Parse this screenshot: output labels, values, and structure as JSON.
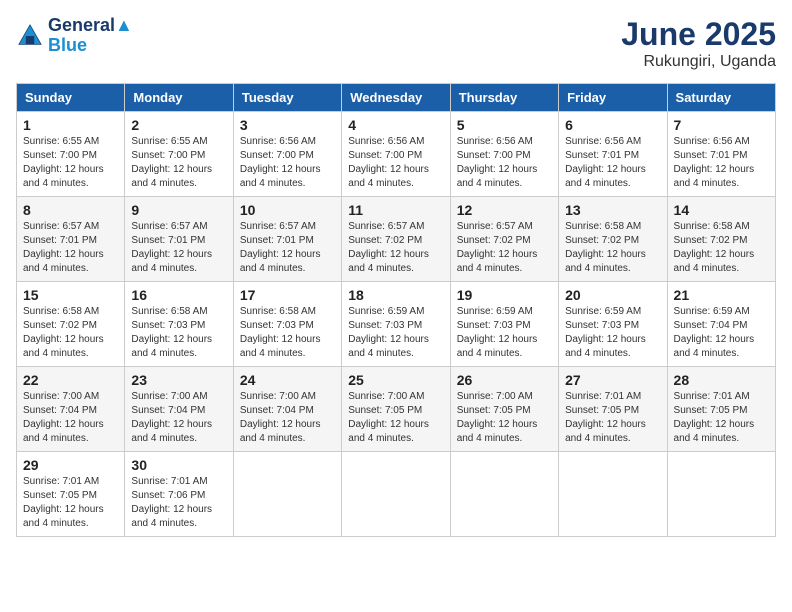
{
  "header": {
    "logo_line1": "General",
    "logo_line2": "Blue",
    "title": "June 2025",
    "subtitle": "Rukungiri, Uganda"
  },
  "columns": [
    "Sunday",
    "Monday",
    "Tuesday",
    "Wednesday",
    "Thursday",
    "Friday",
    "Saturday"
  ],
  "weeks": [
    [
      {
        "day": "1",
        "sunrise": "6:55 AM",
        "sunset": "7:00 PM",
        "daylight": "12 hours and 4 minutes."
      },
      {
        "day": "2",
        "sunrise": "6:55 AM",
        "sunset": "7:00 PM",
        "daylight": "12 hours and 4 minutes."
      },
      {
        "day": "3",
        "sunrise": "6:56 AM",
        "sunset": "7:00 PM",
        "daylight": "12 hours and 4 minutes."
      },
      {
        "day": "4",
        "sunrise": "6:56 AM",
        "sunset": "7:00 PM",
        "daylight": "12 hours and 4 minutes."
      },
      {
        "day": "5",
        "sunrise": "6:56 AM",
        "sunset": "7:00 PM",
        "daylight": "12 hours and 4 minutes."
      },
      {
        "day": "6",
        "sunrise": "6:56 AM",
        "sunset": "7:01 PM",
        "daylight": "12 hours and 4 minutes."
      },
      {
        "day": "7",
        "sunrise": "6:56 AM",
        "sunset": "7:01 PM",
        "daylight": "12 hours and 4 minutes."
      }
    ],
    [
      {
        "day": "8",
        "sunrise": "6:57 AM",
        "sunset": "7:01 PM",
        "daylight": "12 hours and 4 minutes."
      },
      {
        "day": "9",
        "sunrise": "6:57 AM",
        "sunset": "7:01 PM",
        "daylight": "12 hours and 4 minutes."
      },
      {
        "day": "10",
        "sunrise": "6:57 AM",
        "sunset": "7:01 PM",
        "daylight": "12 hours and 4 minutes."
      },
      {
        "day": "11",
        "sunrise": "6:57 AM",
        "sunset": "7:02 PM",
        "daylight": "12 hours and 4 minutes."
      },
      {
        "day": "12",
        "sunrise": "6:57 AM",
        "sunset": "7:02 PM",
        "daylight": "12 hours and 4 minutes."
      },
      {
        "day": "13",
        "sunrise": "6:58 AM",
        "sunset": "7:02 PM",
        "daylight": "12 hours and 4 minutes."
      },
      {
        "day": "14",
        "sunrise": "6:58 AM",
        "sunset": "7:02 PM",
        "daylight": "12 hours and 4 minutes."
      }
    ],
    [
      {
        "day": "15",
        "sunrise": "6:58 AM",
        "sunset": "7:02 PM",
        "daylight": "12 hours and 4 minutes."
      },
      {
        "day": "16",
        "sunrise": "6:58 AM",
        "sunset": "7:03 PM",
        "daylight": "12 hours and 4 minutes."
      },
      {
        "day": "17",
        "sunrise": "6:58 AM",
        "sunset": "7:03 PM",
        "daylight": "12 hours and 4 minutes."
      },
      {
        "day": "18",
        "sunrise": "6:59 AM",
        "sunset": "7:03 PM",
        "daylight": "12 hours and 4 minutes."
      },
      {
        "day": "19",
        "sunrise": "6:59 AM",
        "sunset": "7:03 PM",
        "daylight": "12 hours and 4 minutes."
      },
      {
        "day": "20",
        "sunrise": "6:59 AM",
        "sunset": "7:03 PM",
        "daylight": "12 hours and 4 minutes."
      },
      {
        "day": "21",
        "sunrise": "6:59 AM",
        "sunset": "7:04 PM",
        "daylight": "12 hours and 4 minutes."
      }
    ],
    [
      {
        "day": "22",
        "sunrise": "7:00 AM",
        "sunset": "7:04 PM",
        "daylight": "12 hours and 4 minutes."
      },
      {
        "day": "23",
        "sunrise": "7:00 AM",
        "sunset": "7:04 PM",
        "daylight": "12 hours and 4 minutes."
      },
      {
        "day": "24",
        "sunrise": "7:00 AM",
        "sunset": "7:04 PM",
        "daylight": "12 hours and 4 minutes."
      },
      {
        "day": "25",
        "sunrise": "7:00 AM",
        "sunset": "7:05 PM",
        "daylight": "12 hours and 4 minutes."
      },
      {
        "day": "26",
        "sunrise": "7:00 AM",
        "sunset": "7:05 PM",
        "daylight": "12 hours and 4 minutes."
      },
      {
        "day": "27",
        "sunrise": "7:01 AM",
        "sunset": "7:05 PM",
        "daylight": "12 hours and 4 minutes."
      },
      {
        "day": "28",
        "sunrise": "7:01 AM",
        "sunset": "7:05 PM",
        "daylight": "12 hours and 4 minutes."
      }
    ],
    [
      {
        "day": "29",
        "sunrise": "7:01 AM",
        "sunset": "7:05 PM",
        "daylight": "12 hours and 4 minutes."
      },
      {
        "day": "30",
        "sunrise": "7:01 AM",
        "sunset": "7:06 PM",
        "daylight": "12 hours and 4 minutes."
      },
      null,
      null,
      null,
      null,
      null
    ]
  ],
  "labels": {
    "sunrise": "Sunrise:",
    "sunset": "Sunset:",
    "daylight": "Daylight:"
  }
}
